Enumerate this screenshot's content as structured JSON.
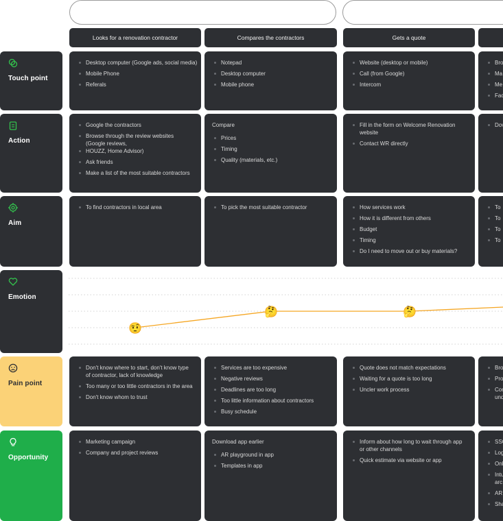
{
  "stages": [
    "Looks for a renovation contractor",
    "Compares the contractors",
    "Gets a quote",
    ""
  ],
  "rows": {
    "touch_point": {
      "label": "Touch point",
      "icon": "rings-icon",
      "cells": [
        {
          "items": [
            "Desktop computer (Google ads, social media)",
            "Mobile Phone",
            "Referals"
          ]
        },
        {
          "items": [
            "Notepad",
            "Desktop computer",
            "Mobile phone"
          ]
        },
        {
          "items": [
            "Website (desktop or mobile)",
            "Call (from Google)",
            "Intercom"
          ]
        },
        {
          "items": [
            "Bro",
            "Ma",
            "Me",
            "Fac"
          ]
        }
      ]
    },
    "action": {
      "label": "Action",
      "icon": "clipboard-icon",
      "cells": [
        {
          "items": [
            "Google the contractors",
            "Browse through the review websites (Google reviews,",
            "HOUZZ, Home Advisor)",
            "Ask friends",
            "Make a list of the most suitable contractors"
          ]
        },
        {
          "intro": "Compare",
          "items": [
            "Prices",
            "Timing",
            "Quality (materials, etc.)"
          ]
        },
        {
          "items": [
            "Fill in the form on Welcome Renovation website",
            "Contact WR directly"
          ]
        },
        {
          "items": [
            "Dov"
          ]
        }
      ]
    },
    "aim": {
      "label": "Aim",
      "icon": "target-icon",
      "cells": [
        {
          "items": [
            "To find contractors in local area"
          ]
        },
        {
          "items": [
            "To pick the most suitable contractor"
          ]
        },
        {
          "items": [
            "How services work",
            "How it is different from others",
            "Budget",
            "Timing",
            "Do I need to move out or buy materials?"
          ]
        },
        {
          "items": [
            "To",
            "To",
            "To",
            "To"
          ]
        }
      ]
    },
    "emotion": {
      "label": "Emotion",
      "icon": "heart-icon",
      "faces": [
        "🤨",
        "🤔",
        "🤔"
      ]
    },
    "pain_point": {
      "label": "Pain point",
      "icon": "sad-face-icon",
      "cells": [
        {
          "items": [
            "Don't know where to start, don't know type of contractor, lack of knowledge",
            "Too many or too little contractors in the area",
            "Don't know whom to trust"
          ]
        },
        {
          "items": [
            "Services are too expensive",
            "Negative reviews",
            "Deadlines are too long",
            "Too little information about contractors",
            "Busy schedule"
          ]
        },
        {
          "items": [
            "Quote does not match expectations",
            "Waiting for a quote is too long",
            "Uncler work process"
          ]
        },
        {
          "items": [
            "Bro",
            "Pro",
            "Con und"
          ]
        }
      ]
    },
    "opportunity": {
      "label": "Opportunity",
      "icon": "lightbulb-icon",
      "cells": [
        {
          "items": [
            "Marketing campaign",
            "Company and project reviews"
          ]
        },
        {
          "intro": "Download app earlier",
          "items": [
            "AR playground in app",
            "Templates in app"
          ]
        },
        {
          "items": [
            "Inform about how long to wait through app or other channels",
            "Quick estimate via website or app"
          ]
        },
        {
          "items": [
            "SSO",
            "Log",
            "Onl",
            "Intu arc",
            "AR",
            "Sha"
          ]
        }
      ]
    }
  },
  "colors": {
    "card": "#2d2f33",
    "accent_green": "#33c24d",
    "pain_yellow": "#fbd277",
    "opportunity_green": "#1fae4a",
    "emotion_line": "#f5a623"
  },
  "chart_data": {
    "type": "line",
    "x": [
      "Looks for a renovation contractor",
      "Compares the contractors",
      "Gets a quote",
      ""
    ],
    "series": [
      {
        "values": [
          1,
          2,
          2,
          2.3
        ]
      }
    ],
    "ylim": [
      0,
      4
    ],
    "grid": true
  }
}
